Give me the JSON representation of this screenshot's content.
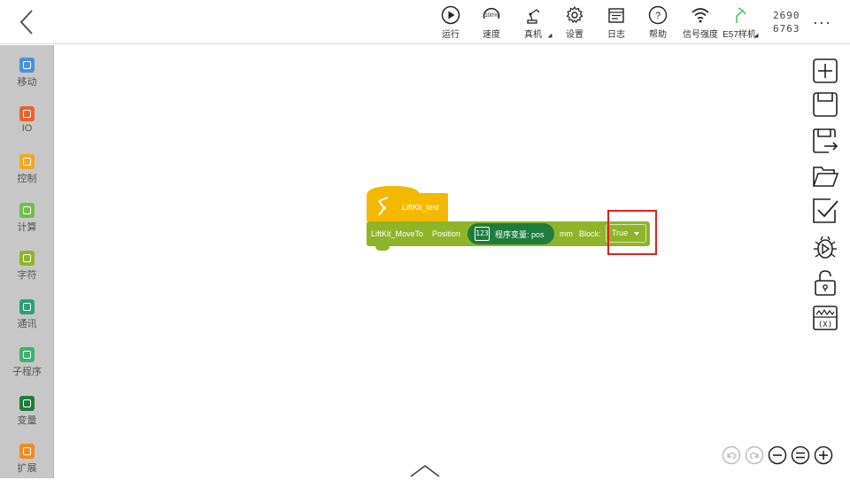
{
  "toolbar": {
    "items": [
      {
        "label": "运行",
        "icon": "play-icon"
      },
      {
        "label": "速度",
        "icon": "speed-gauge-icon",
        "gauge_text": "100%"
      },
      {
        "label": "真机",
        "icon": "robot-arm-icon"
      },
      {
        "label": "设置",
        "icon": "gear-icon"
      },
      {
        "label": "日志",
        "icon": "log-icon"
      },
      {
        "label": "帮助",
        "icon": "help-icon"
      },
      {
        "label": "信号强度",
        "icon": "wifi-icon"
      },
      {
        "label": "E57样机",
        "icon": "robot-model-icon"
      }
    ],
    "coords": {
      "line1": "2690",
      "line2": "6763"
    },
    "more_label": "···"
  },
  "sidebar": {
    "items": [
      {
        "label": "移动",
        "color": "#4a90e2"
      },
      {
        "label": "IO",
        "color": "#e8622c"
      },
      {
        "label": "控制",
        "color": "#f5a623"
      },
      {
        "label": "计算",
        "color": "#6cbf4a"
      },
      {
        "label": "字符",
        "color": "#8fb42a"
      },
      {
        "label": "通讯",
        "color": "#2aa07a"
      },
      {
        "label": "子程序",
        "color": "#3cb371"
      },
      {
        "label": "变量",
        "color": "#1e7c3f"
      },
      {
        "label": "扩展",
        "color": "#f08c1e"
      }
    ]
  },
  "blocks": {
    "hat_label": "LiftKit_test",
    "command": "LiftKit_MoveTo",
    "position_label": "Position",
    "variable_badge": "123",
    "variable_text": "程序变量: pos",
    "unit": "mm",
    "block_label": "Block:",
    "block_value": "True"
  },
  "colors": {
    "hat": "#f5b800",
    "command": "#8fb42a",
    "variable": "#1e7c3f",
    "highlight": "#e02020"
  }
}
